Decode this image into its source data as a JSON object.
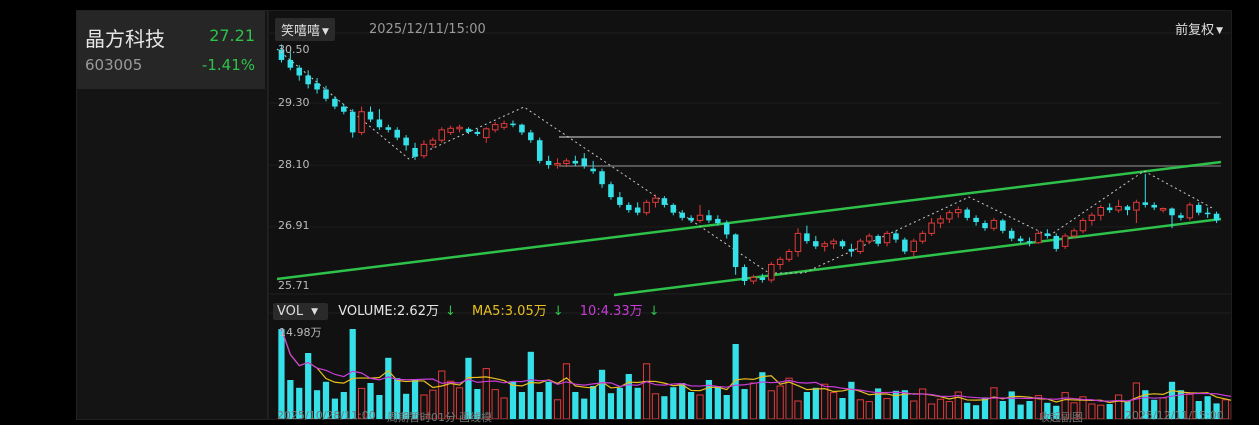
{
  "stock": {
    "name": "晶方科技",
    "price": "27.21",
    "code": "603005",
    "change": "-1.41%"
  },
  "toolbar": {
    "mode_label": "笑嘻嘻",
    "datetime": "2025/12/11/15:00",
    "adjust_label": "前复权"
  },
  "price_axis": {
    "labels": [
      "30.50",
      "29.30",
      "28.10",
      "26.91",
      "25.71"
    ]
  },
  "volume": {
    "selector_label": "VOL",
    "volume_text": "VOLUME:2.62万",
    "ma5_text": "MA5:3.05万",
    "ma10_text": "10:4.33万",
    "max_label": "14.98万"
  },
  "footer": {
    "start_date": "2025/10/28/11:00",
    "period": "周期暂时01分",
    "tool": "画线模",
    "left_text": "收起副图",
    "end_date": "2025/12/11/15:00"
  },
  "colors": {
    "up": "#e03a3a",
    "down": "#35e0e8",
    "green": "#2ec24a",
    "ma5": "#e8c020",
    "ma10": "#c83cd8"
  },
  "chart_data": {
    "type": "candlestick",
    "ylim": [
      25.71,
      30.5
    ],
    "ohlc": [
      [
        30.45,
        30.55,
        30.2,
        30.25
      ],
      [
        30.25,
        30.4,
        30.05,
        30.1
      ],
      [
        30.1,
        30.15,
        29.85,
        29.95
      ],
      [
        29.95,
        30.05,
        29.7,
        29.78
      ],
      [
        29.8,
        29.9,
        29.6,
        29.68
      ],
      [
        29.68,
        29.75,
        29.45,
        29.5
      ],
      [
        29.5,
        29.55,
        29.3,
        29.35
      ],
      [
        29.35,
        29.4,
        29.2,
        29.25
      ],
      [
        29.25,
        29.3,
        28.75,
        28.85
      ],
      [
        28.85,
        29.35,
        28.8,
        29.25
      ],
      [
        29.25,
        29.35,
        29.05,
        29.1
      ],
      [
        29.1,
        29.3,
        28.9,
        28.95
      ],
      [
        28.95,
        29.0,
        28.85,
        28.9
      ],
      [
        28.9,
        28.95,
        28.7,
        28.75
      ],
      [
        28.75,
        28.8,
        28.5,
        28.6
      ],
      [
        28.55,
        28.65,
        28.32,
        28.38
      ],
      [
        28.4,
        28.7,
        28.35,
        28.62
      ],
      [
        28.62,
        28.75,
        28.55,
        28.7
      ],
      [
        28.7,
        28.95,
        28.65,
        28.9
      ],
      [
        28.85,
        28.98,
        28.8,
        28.93
      ],
      [
        28.92,
        29.0,
        28.85,
        28.95
      ],
      [
        28.92,
        28.95,
        28.82,
        28.86
      ],
      [
        28.86,
        28.92,
        28.78,
        28.82
      ],
      [
        28.75,
        28.95,
        28.65,
        28.92
      ],
      [
        28.9,
        29.05,
        28.85,
        29.0
      ],
      [
        28.95,
        29.08,
        28.9,
        29.02
      ],
      [
        29.02,
        29.08,
        28.95,
        29.0
      ],
      [
        29.0,
        29.02,
        28.8,
        28.85
      ],
      [
        28.85,
        28.9,
        28.65,
        28.7
      ],
      [
        28.7,
        28.75,
        28.25,
        28.3
      ],
      [
        28.3,
        28.4,
        28.15,
        28.22
      ],
      [
        28.22,
        28.35,
        28.15,
        28.25
      ],
      [
        28.25,
        28.35,
        28.18,
        28.3
      ],
      [
        28.3,
        28.4,
        28.2,
        28.25
      ],
      [
        28.35,
        28.45,
        28.15,
        28.2
      ],
      [
        28.15,
        28.3,
        28.05,
        28.1
      ],
      [
        28.1,
        28.15,
        27.78,
        27.85
      ],
      [
        27.85,
        27.9,
        27.55,
        27.6
      ],
      [
        27.6,
        27.7,
        27.4,
        27.45
      ],
      [
        27.45,
        27.5,
        27.3,
        27.35
      ],
      [
        27.4,
        27.5,
        27.25,
        27.3
      ],
      [
        27.3,
        27.55,
        27.25,
        27.5
      ],
      [
        27.5,
        27.65,
        27.4,
        27.58
      ],
      [
        27.58,
        27.62,
        27.4,
        27.45
      ],
      [
        27.45,
        27.48,
        27.25,
        27.3
      ],
      [
        27.3,
        27.35,
        27.15,
        27.2
      ],
      [
        27.2,
        27.25,
        27.1,
        27.15
      ],
      [
        27.15,
        27.45,
        27.1,
        27.25
      ],
      [
        27.25,
        27.35,
        27.1,
        27.15
      ],
      [
        27.18,
        27.25,
        27.05,
        27.1
      ],
      [
        27.1,
        27.15,
        26.8,
        26.88
      ],
      [
        26.88,
        26.9,
        26.1,
        26.25
      ],
      [
        26.25,
        26.3,
        25.9,
        25.98
      ],
      [
        25.98,
        26.1,
        25.92,
        26.05
      ],
      [
        26.05,
        26.12,
        25.95,
        26.0
      ],
      [
        26.0,
        26.35,
        25.95,
        26.3
      ],
      [
        26.3,
        26.45,
        26.2,
        26.4
      ],
      [
        26.4,
        26.6,
        26.35,
        26.55
      ],
      [
        26.55,
        27.0,
        26.45,
        26.9
      ],
      [
        26.9,
        27.05,
        26.7,
        26.75
      ],
      [
        26.75,
        26.85,
        26.6,
        26.65
      ],
      [
        26.65,
        26.75,
        26.55,
        26.7
      ],
      [
        26.7,
        26.8,
        26.6,
        26.75
      ],
      [
        26.75,
        26.78,
        26.6,
        26.65
      ],
      [
        26.6,
        26.7,
        26.45,
        26.55
      ],
      [
        26.55,
        26.8,
        26.5,
        26.75
      ],
      [
        26.75,
        26.9,
        26.7,
        26.85
      ],
      [
        26.85,
        26.88,
        26.65,
        26.7
      ],
      [
        26.72,
        26.95,
        26.65,
        26.9
      ],
      [
        26.9,
        26.95,
        26.72,
        26.78
      ],
      [
        26.78,
        26.82,
        26.5,
        26.55
      ],
      [
        26.55,
        26.8,
        26.45,
        26.75
      ],
      [
        26.75,
        26.95,
        26.7,
        26.9
      ],
      [
        26.9,
        27.2,
        26.85,
        27.1
      ],
      [
        27.1,
        27.25,
        27.0,
        27.18
      ],
      [
        27.18,
        27.35,
        27.1,
        27.3
      ],
      [
        27.3,
        27.42,
        27.2,
        27.36
      ],
      [
        27.36,
        27.4,
        27.15,
        27.2
      ],
      [
        27.2,
        27.25,
        27.05,
        27.12
      ],
      [
        27.1,
        27.15,
        26.95,
        27.0
      ],
      [
        27.0,
        27.2,
        26.95,
        27.15
      ],
      [
        27.15,
        27.18,
        26.9,
        26.95
      ],
      [
        26.95,
        27.0,
        26.75,
        26.8
      ],
      [
        26.8,
        26.85,
        26.7,
        26.75
      ],
      [
        26.75,
        26.82,
        26.65,
        26.72
      ],
      [
        26.72,
        26.95,
        26.7,
        26.9
      ],
      [
        26.9,
        26.98,
        26.8,
        26.85
      ],
      [
        26.85,
        26.9,
        26.55,
        26.6
      ],
      [
        26.65,
        26.9,
        26.6,
        26.85
      ],
      [
        26.85,
        27.0,
        26.8,
        26.95
      ],
      [
        26.95,
        27.2,
        26.9,
        27.15
      ],
      [
        27.15,
        27.3,
        27.05,
        27.25
      ],
      [
        27.25,
        27.45,
        27.15,
        27.4
      ],
      [
        27.4,
        27.48,
        27.3,
        27.35
      ],
      [
        27.35,
        27.55,
        27.3,
        27.42
      ],
      [
        27.42,
        27.45,
        27.25,
        27.35
      ],
      [
        27.35,
        27.55,
        27.1,
        27.5
      ],
      [
        27.5,
        28.05,
        27.4,
        27.45
      ],
      [
        27.45,
        27.5,
        27.35,
        27.4
      ],
      [
        27.35,
        27.4,
        27.3,
        27.38
      ],
      [
        27.38,
        27.4,
        27.0,
        27.25
      ],
      [
        27.25,
        27.3,
        27.15,
        27.2
      ],
      [
        27.2,
        27.5,
        27.15,
        27.45
      ],
      [
        27.45,
        27.5,
        27.25,
        27.3
      ],
      [
        27.3,
        27.4,
        27.2,
        27.28
      ],
      [
        27.28,
        27.32,
        27.1,
        27.15
      ]
    ],
    "volume": [
      14.98,
      6.5,
      5.2,
      11.0,
      4.8,
      6.2,
      3.4,
      4.5,
      15.0,
      5.1,
      6.0,
      4.0,
      10.2,
      6.8,
      4.2,
      6.5,
      4.0,
      4.8,
      8.0,
      6.3,
      5.2,
      10.2,
      5.0,
      8.4,
      4.9,
      3.5,
      6.3,
      4.5,
      11.2,
      4.5,
      6.2,
      3.2,
      9.2,
      4.5,
      3.4,
      5.5,
      8.2,
      4.3,
      5.2,
      7.5,
      5.2,
      9.2,
      4.2,
      3.8,
      5.3,
      6.0,
      4.5,
      4.0,
      6.5,
      5.5,
      4.0,
      12.5,
      5.0,
      6.0,
      7.8,
      4.7,
      5.5,
      6.8,
      3.0,
      4.5,
      5.2,
      5.8,
      4.4,
      3.5,
      6.2,
      3.2,
      2.9,
      5.1,
      3.4,
      4.7,
      4.8,
      3.0,
      5.0,
      2.5,
      3.3,
      2.9,
      4.5,
      2.7,
      2.3,
      3.6,
      5.2,
      3.0,
      4.6,
      2.4,
      3.0,
      3.9,
      2.7,
      2.2,
      4.4,
      2.7,
      3.7,
      2.5,
      2.3,
      2.5,
      4.0,
      3.0,
      6.0,
      4.8,
      3.2,
      3.5,
      6.2,
      4.8,
      4.1,
      3.0,
      3.8,
      2.6,
      3.2,
      2.4,
      3.1,
      2.6
    ],
    "series_ma5_label": "MA5",
    "series_ma10_label": "10"
  }
}
